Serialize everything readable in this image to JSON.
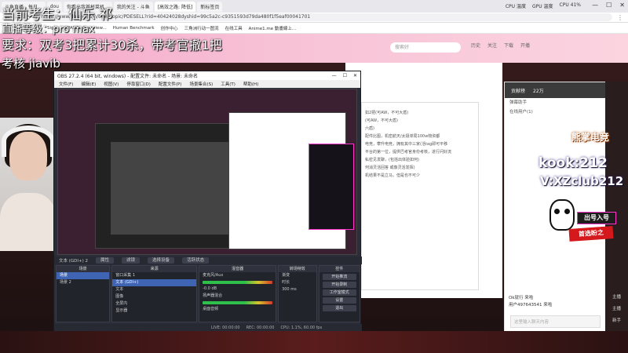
{
  "browser": {
    "tabs": [
      "斗鱼直播 - 每日...",
      "dou",
      "你看出我首杯菜机...",
      "我的关注 - 斗鱼",
      "[高效之路: 降低]",
      "新标签页"
    ],
    "url": "https://www.douyu.com/beta/topic/PDESELL?rid=40424028dyshid=99c5a2c-c9351593d79da480f1f5eaf00041701",
    "sysinfo": [
      "CPU 温度",
      "GPU 温度",
      "CPU 41%"
    ],
    "window_controls": [
      "—",
      "☐",
      "✕"
    ],
    "bookmarks": [
      "Sight",
      "XPANEL Overview...",
      "Human Benchmark",
      "创作中心",
      "三角洲行动一图流",
      "在线工具",
      "Anime1.me 動畫線上..."
    ]
  },
  "site": {
    "search_placeholder": "搜索好",
    "header_icons": [
      "历史",
      "关注",
      "下载",
      "开播"
    ]
  },
  "overlay": {
    "line1": "当前考生：仙乐 祁",
    "line2": "直播等级：pro max",
    "line3": "要求：双考3把累计30杀，带考官撤1把",
    "line4": "考核 jiavib"
  },
  "obs": {
    "title": "OBS 27.2.4 (64 bit, windows) - 配置文件: 未命名 - 场景: 未命名",
    "menu": [
      "文件(F)",
      "编辑(E)",
      "视图(V)",
      "停靠窗口(D)",
      "配置文件(P)",
      "场景集合(S)",
      "工具(T)",
      "帮助(H)"
    ],
    "source_ctrl": [
      "文本 (GDI+) 2",
      "属性",
      "滤镜",
      "选择设备",
      "活跃状态"
    ],
    "docks": {
      "scenes": {
        "title": "场景",
        "items": [
          "场景",
          "场景 2"
        ]
      },
      "sources": {
        "title": "来源",
        "items": [
          "窗口采集 1",
          "文本 (GDI+)",
          "文本",
          "图像",
          "全屏内",
          "显示器",
          "文本"
        ]
      },
      "mixer": {
        "title": "混音器",
        "items": [
          "麦克风/Aux",
          "-0.0 dB",
          "扬声器混合",
          "0.0 dB",
          "桌面音频"
        ]
      },
      "transitions": {
        "title": "转场特效",
        "items": [
          "渐变",
          "时长",
          "300 ms"
        ]
      },
      "controls": {
        "title": "控件",
        "buttons": [
          "开始推流",
          "开始录制",
          "工作室模式",
          "设置",
          "退出"
        ]
      }
    },
    "status": [
      "LIVE: 00:00:00",
      "REC: 00:00:00",
      "CPU: 1.1%, 60.00 fps"
    ]
  },
  "doc_lines": [
    "如2把(可AW，不可大盾)",
    "(可AW，不可大盾)",
    "六盾)",
    "配件比图，机密航天/太极单局100w物资都",
    "电竞，攀升电竞，拥有其中三家(活tag即可平移",
    "平台的第一位，提供巴考官身份考核，进行问好流",
    "私密见发聊，(包括出体验如何)",
    "何消灵活回答 或像灵活发挥)",
    "机结果不是立马，但是也不可少"
  ],
  "chat": {
    "top": [
      "贡献榜",
      "22万",
      "弹幕助手"
    ],
    "messages": [
      "在线用户(1)",
      "欢迎来到本直播间，斗鱼严禁未成年人直播或打赏，主播打造绿色健康直播",
      "来，点击前往查看更多活动详情",
      "查看更多"
    ],
    "gifts": [
      "Ok就行 来啦",
      "用户497643541 来啦"
    ],
    "input_placeholder": "这里输入聊天内容",
    "send": "发送"
  },
  "ad": {
    "brand": "熊掌电竞",
    "line1": "kook:212",
    "line2": "V:XZclub212",
    "badge1": "出号入号",
    "badge2": "首选盼之",
    "panzhi": "PANZHI"
  },
  "right_sidebar": [
    "主播",
    "主播",
    "新手"
  ]
}
